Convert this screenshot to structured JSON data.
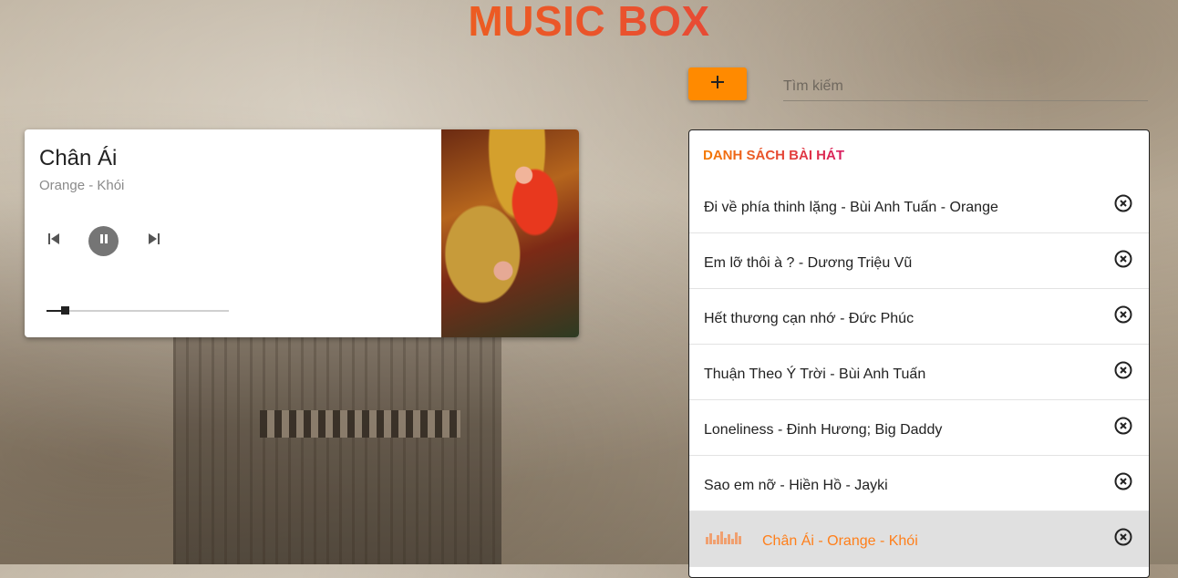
{
  "app": {
    "title": "MUSIC BOX"
  },
  "toolbar": {
    "add_label": "+",
    "search_placeholder": "Tìm kiếm"
  },
  "player": {
    "song_title": "Chân Ái",
    "artist": "Orange - Khói",
    "progress": 0.1,
    "state": "playing",
    "icons": {
      "prev": "skip-previous-icon",
      "pause": "pause-icon",
      "next": "skip-next-icon"
    }
  },
  "playlist": {
    "header": "DANH SÁCH BÀI HÁT",
    "items": [
      {
        "label": "Đi về phía thinh lặng - Bùi Anh Tuấn - Orange",
        "active": false
      },
      {
        "label": "Em lỡ thôi à ? - Dương Triệu Vũ",
        "active": false
      },
      {
        "label": "Hết thương cạn nhớ - Đức Phúc",
        "active": false
      },
      {
        "label": "Thuận Theo Ý Trời - Bùi Anh Tuấn",
        "active": false
      },
      {
        "label": "Loneliness - Đinh Hương; Big Daddy",
        "active": false
      },
      {
        "label": "Sao em nỡ - Hiền Hồ - Jayki",
        "active": false
      },
      {
        "label": "Chân Ái - Orange - Khói",
        "active": true
      }
    ]
  },
  "colors": {
    "accent": "#ff8a00",
    "title_gradient_start": "#f57c00",
    "title_gradient_end": "#d81b60"
  }
}
